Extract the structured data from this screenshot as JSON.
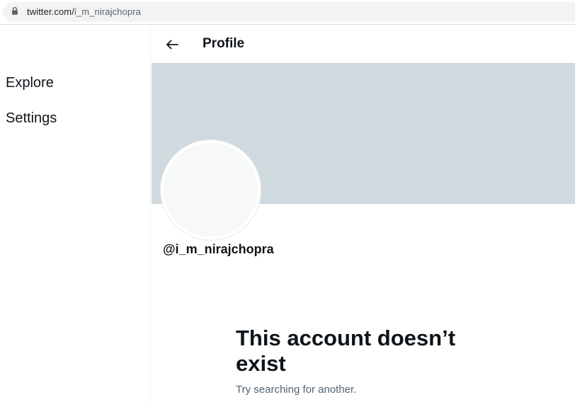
{
  "browser": {
    "url_host": "twitter.com/",
    "url_path": "i_m_nirajchopra"
  },
  "sidebar": {
    "items": [
      {
        "label": "Explore"
      },
      {
        "label": "Settings"
      }
    ]
  },
  "header": {
    "title": "Profile"
  },
  "profile": {
    "handle": "@i_m_nirajchopra"
  },
  "empty_state": {
    "title": "This account doesn’t exist",
    "subtitle": "Try searching for another."
  },
  "colors": {
    "banner": "#cfd9de",
    "avatar_fill": "#f7f9f9",
    "text_primary": "#0f1419",
    "text_secondary": "#536471"
  }
}
